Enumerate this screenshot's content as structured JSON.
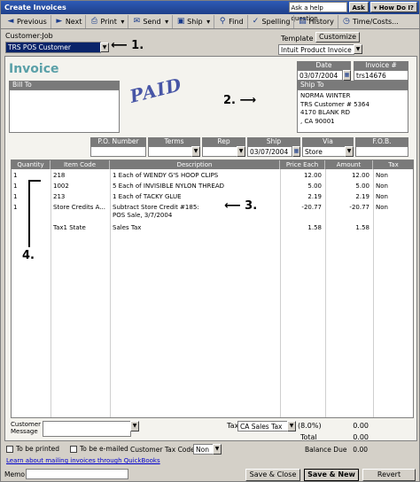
{
  "window": {
    "title": "Create Invoices",
    "help_placeholder": "Ask a help question",
    "ask_label": "Ask",
    "howdoi_label": "How Do I?"
  },
  "toolbar": {
    "previous": "Previous",
    "next": "Next",
    "print": "Print",
    "send": "Send",
    "ship": "Ship",
    "find": "Find",
    "spelling": "Spelling",
    "history": "History",
    "time_costs": "Time/Costs..."
  },
  "header": {
    "customer_job_label": "Customer:Job",
    "customer_job_value": "TRS POS Customer",
    "template_label": "Template",
    "customize_label": "Customize",
    "template_value": "Intuit Product Invoice"
  },
  "form": {
    "title": "Invoice",
    "stamp": "PAID",
    "date_label": "Date",
    "date_value": "03/07/2004",
    "invoice_no_label": "Invoice #",
    "invoice_no_value": "trs14676",
    "bill_to_label": "Bill To",
    "ship_to_label": "Ship To",
    "ship_to_lines": [
      "NORMA WINTER",
      "TRS Customer # 5364",
      "4170 BLANK RD",
      ", CA 90001"
    ],
    "po_label": "P.O. Number",
    "terms_label": "Terms",
    "rep_label": "Rep",
    "ship_label": "Ship",
    "ship_value": "03/07/2004",
    "via_label": "Via",
    "via_value": "Store",
    "fob_label": "F.O.B."
  },
  "annotations": {
    "a1": "1.",
    "a2": "2.",
    "a3": "3.",
    "a4": "4."
  },
  "table": {
    "columns": [
      "Quantity",
      "Item Code",
      "Description",
      "Price Each",
      "Amount",
      "Tax"
    ],
    "rows": [
      {
        "qty": "1",
        "item": "218",
        "desc": "1 Each of WENDY G'S HOOP CLIPS",
        "desc2": "",
        "price": "12.00",
        "amount": "12.00",
        "tax": "Non"
      },
      {
        "qty": "1",
        "item": "1002",
        "desc": "5 Each of INVISIBLE NYLON THREAD",
        "desc2": "",
        "price": "5.00",
        "amount": "5.00",
        "tax": "Non"
      },
      {
        "qty": "1",
        "item": "213",
        "desc": "1 Each of TACKY GLUE",
        "desc2": "",
        "price": "2.19",
        "amount": "2.19",
        "tax": "Non"
      },
      {
        "qty": "1",
        "item": "Store Credits A...",
        "desc": "Subtract Store Credit #185:",
        "desc2": "POS Sale, 3/7/2004",
        "price": "-20.77",
        "amount": "-20.77",
        "tax": "Non"
      },
      {
        "qty": "",
        "item": "Tax1 State",
        "desc": "Sales Tax",
        "desc2": "",
        "price": "1.58",
        "amount": "1.58",
        "tax": ""
      }
    ]
  },
  "footer": {
    "customer_message_label": "Customer\nMessage",
    "tax_label": "Tax",
    "tax_value": "CA Sales Tax",
    "tax_rate": "(8.0%)",
    "tax_amount": "0.00",
    "total_label": "Total",
    "total_value": "0.00",
    "to_be_printed": "To be printed",
    "to_be_emailed": "To be e-mailed",
    "customer_tax_code_label": "Customer Tax Code",
    "customer_tax_code_value": "Non",
    "balance_due_label": "Balance Due",
    "balance_due_value": "0.00",
    "learn_link": "Learn about mailing invoices through QuickBooks",
    "memo_label": "Memo",
    "save_close": "Save & Close",
    "save_new": "Save & New",
    "revert": "Revert"
  }
}
